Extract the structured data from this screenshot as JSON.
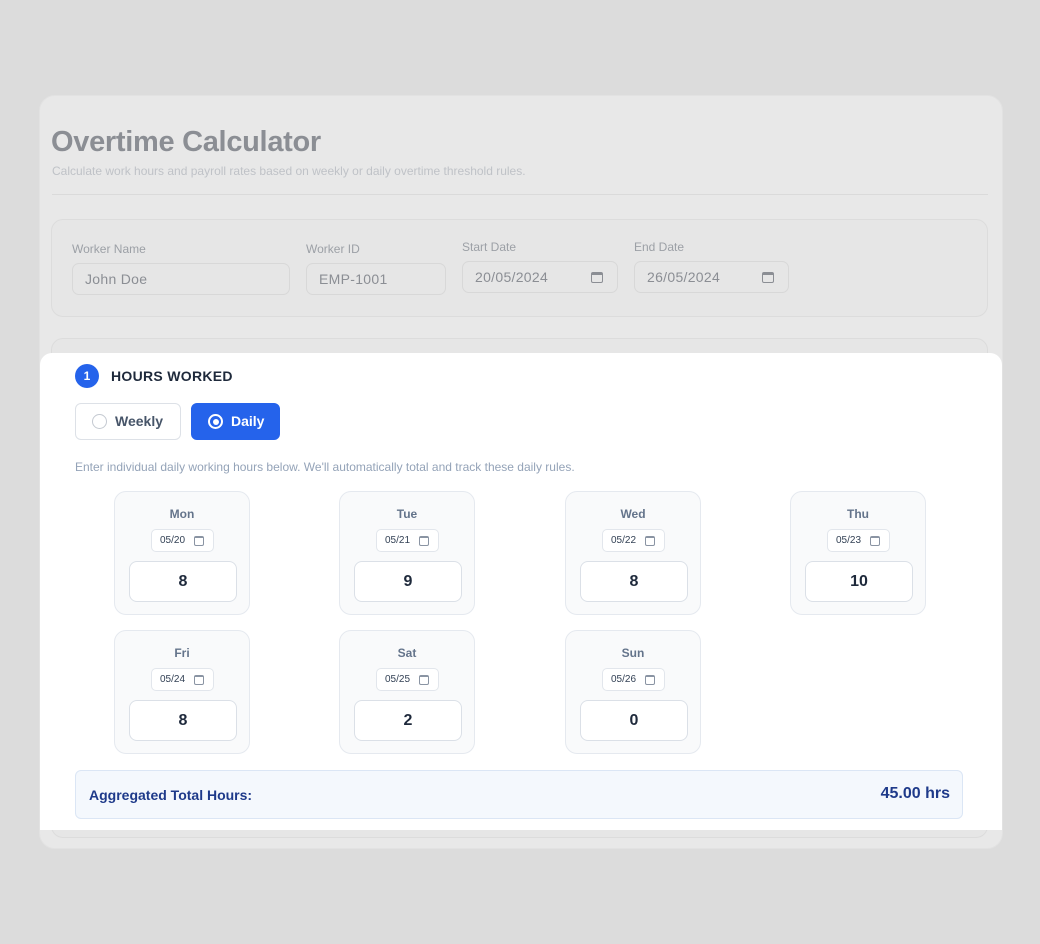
{
  "header": {
    "title": "Overtime Calculator",
    "subtitle": "Calculate work hours and payroll rates based on weekly or daily overtime threshold rules."
  },
  "info": {
    "worker_name": {
      "label": "Worker Name",
      "value": "John Doe"
    },
    "worker_id": {
      "label": "Worker ID",
      "value": "EMP-1001"
    },
    "start_date": {
      "label": "Start Date",
      "value": "20/05/2024"
    },
    "end_date": {
      "label": "End Date",
      "value": "26/05/2024"
    }
  },
  "hours_section": {
    "step": "1",
    "title": "HOURS WORKED",
    "modes": [
      {
        "label": "Weekly",
        "selected": false
      },
      {
        "label": "Daily",
        "selected": true
      }
    ],
    "hint": "Enter individual daily working hours below. We'll automatically total and track these daily rules.",
    "days": [
      {
        "name": "Mon",
        "date": "05/20",
        "hours": "8"
      },
      {
        "name": "Tue",
        "date": "05/21",
        "hours": "9"
      },
      {
        "name": "Wed",
        "date": "05/22",
        "hours": "8"
      },
      {
        "name": "Thu",
        "date": "05/23",
        "hours": "10"
      },
      {
        "name": "Fri",
        "date": "05/24",
        "hours": "8"
      },
      {
        "name": "Sat",
        "date": "05/25",
        "hours": "2"
      },
      {
        "name": "Sun",
        "date": "05/26",
        "hours": "0"
      }
    ],
    "total_label": "Aggregated Total Hours:",
    "total_value": "45.00 hrs"
  },
  "colors": {
    "accent": "#2563eb",
    "total_text": "#1e3a8a"
  },
  "icons": {
    "date_picker": "calendar-icon",
    "mode_selector": "radio-icon"
  }
}
